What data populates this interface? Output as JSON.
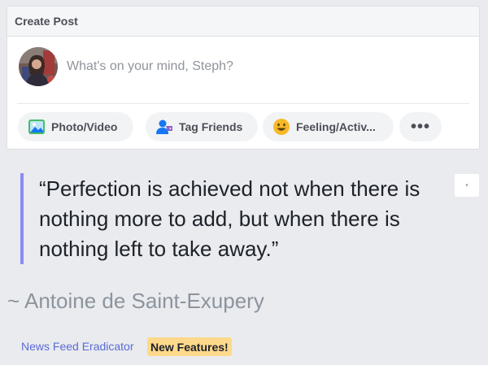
{
  "create_post": {
    "title": "Create Post",
    "placeholder": "What's on your mind, Steph?",
    "actions": [
      {
        "label": "Photo/Video",
        "icon": "photo-icon"
      },
      {
        "label": "Tag Friends",
        "icon": "tag-friends-icon"
      },
      {
        "label": "Feeling/Activ...",
        "icon": "feeling-emoji-icon"
      },
      {
        "label": "•••",
        "icon": "more-icon"
      }
    ]
  },
  "quote": {
    "text": "“Perfection is achieved not when there is nothing more to add, but when there is nothing left to take away.”",
    "author": "~ Antoine de Saint-Exupery",
    "menu_icon": "▾"
  },
  "footer": {
    "link": "News Feed Eradicator",
    "badge": "New Features!"
  },
  "colors": {
    "background": "#e9ebee",
    "quote_bar": "#8c8cf0",
    "link": "#5b6bd5",
    "badge": "#ffd98b"
  }
}
